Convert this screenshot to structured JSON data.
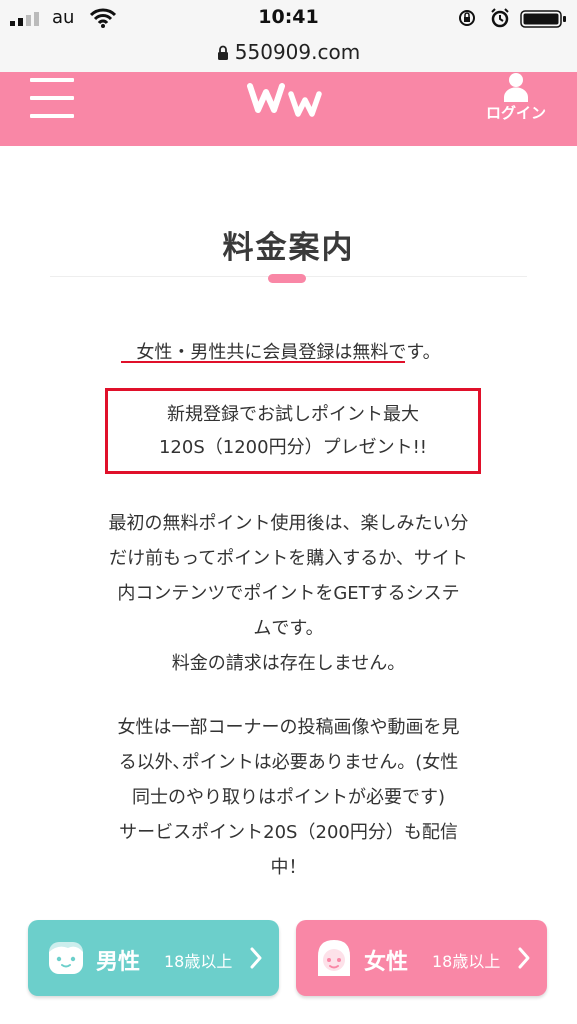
{
  "status_bar": {
    "carrier": "au",
    "time": "10:41"
  },
  "browser": {
    "url": "550909.com"
  },
  "header": {
    "login_label": "ログイン"
  },
  "content": {
    "title": "料金案内",
    "intro": "女性・男性共に会員登録は無料です。",
    "promo_line1": "新規登録でお試しポイント最大",
    "promo_line2": "120S（1200円分）プレゼント!!",
    "para1_lines": [
      "最初の無料ポイント使用後は、楽しみたい分",
      "だけ前もってポイントを購入するか、サイト",
      "内コンテンツでポイントをGETするシステ",
      "ムです。",
      "料金の請求は存在しません。"
    ],
    "para2_lines": [
      "女性は一部コーナーの投稿画像や動画を見",
      "る以外､ポイントは必要ありません。(女性",
      "同士のやり取りはポイントが必要です)",
      "サービスポイント20S（200円分）も配信",
      "中！"
    ]
  },
  "buttons": {
    "male": {
      "label": "男性",
      "age": "18歳以上"
    },
    "female": {
      "label": "女性",
      "age": "18歳以上"
    }
  },
  "colors": {
    "brand_pink": "#f987a6",
    "male_teal": "#6ccfcb",
    "highlight_red": "#e0102a"
  }
}
